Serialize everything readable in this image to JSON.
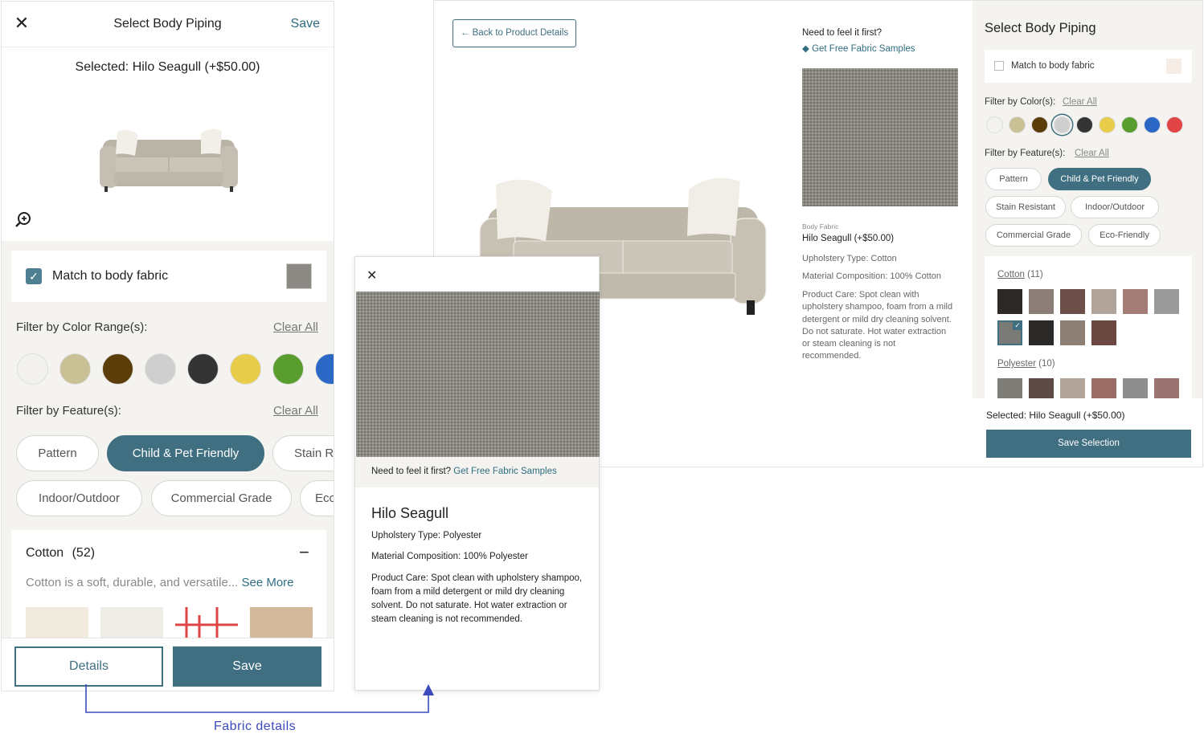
{
  "mobile": {
    "close_glyph": "✕",
    "title": "Select Body Piping",
    "save": "Save",
    "selected": "Selected: Hilo Seagull (+$50.00)",
    "match_label": "Match to body fabric",
    "color_heading": "Filter by Color Range(s):",
    "color_clear": "Clear All",
    "colors": [
      "#f2f1ee",
      "#c9c096",
      "#5a3d08",
      "#cfcfcf",
      "#343434",
      "#e8cd4b",
      "#5a9d2f",
      "#2b68c6"
    ],
    "feature_heading": "Filter by Feature(s):",
    "feature_clear": "Clear All",
    "features_row1": [
      "Pattern",
      "Child & Pet Friendly",
      "Stain Resistant"
    ],
    "features_row2": [
      "Indoor/Outdoor",
      "Commercial Grade",
      "Eco-Friendly"
    ],
    "cotton_title": "Cotton",
    "cotton_count": "(52)",
    "cotton_toggle": "−",
    "cotton_desc": "Cotton is a soft, durable, and versatile...",
    "see_more": "See More",
    "details_button": "Details",
    "save_button": "Save"
  },
  "desktop": {
    "back": "Back to Product Details",
    "need": "Need to feel it first?",
    "samples": "Get Free Fabric Samples",
    "body_fabric_label": "Body Fabric",
    "fabric_name": "Hilo Seagull (+$50.00)",
    "upholstery": "Upholstery Type: Cotton",
    "material": "Material Composition: 100% Cotton",
    "care": "Product Care: Spot clean with upholstery shampoo, foam from a mild detergent or mild dry cleaning solvent. Do not saturate. Hot water extraction or steam cleaning is not recommended.",
    "side_title": "Select Body Piping",
    "match_label": "Match to body fabric",
    "color_heading": "Filter by Color(s):",
    "color_clear": "Clear All",
    "colors": [
      "#f3f2ef",
      "#c9c096",
      "#5a3d08",
      "#cfcfcf",
      "#343434",
      "#e8cd4b",
      "#5a9d2f",
      "#2b68c6",
      "#e04444"
    ],
    "feature_heading": "Filter by Feature(s):",
    "feature_clear": "Clear All",
    "features": [
      "Pattern",
      "Child & Pet Friendly",
      "Stain Resistant",
      "Indoor/Outdoor",
      "Commercial Grade",
      "Eco-Friendly"
    ],
    "cotton_link": "Cotton",
    "cotton_count": "(11)",
    "polyester_link": "Polyester",
    "polyester_count": "(10)",
    "cotton_tiles": [
      "#2c2927",
      "#8a7e76",
      "#6b4f48",
      "#b1a49b",
      "#a47c76",
      "#9a9a9a",
      "#7a7b77",
      "#2a2928",
      "#8e7f75",
      "#6b4842"
    ],
    "polyester_tiles": [
      "#7f7d78",
      "#5e4a45",
      "#b1a59a",
      "#9a6e66",
      "#8e8e8e",
      "#9a7470"
    ],
    "selected": "Selected: Hilo Seagull (+$50.00)",
    "save_selection": "Save Selection"
  },
  "modal": {
    "close_glyph": "✕",
    "need": "Need to feel it first?",
    "samples": "Get Free Fabric Samples",
    "name": "Hilo Seagull",
    "upholstery": "Upholstery Type: Polyester",
    "material": "Material Composition: 100% Polyester",
    "care": "Product Care: Spot clean with upholstery shampoo, foam from a mild detergent or mild dry cleaning solvent. Do not saturate. Hot water extraction or steam cleaning is not recommended."
  },
  "annotation": {
    "label": "Fabric details"
  }
}
